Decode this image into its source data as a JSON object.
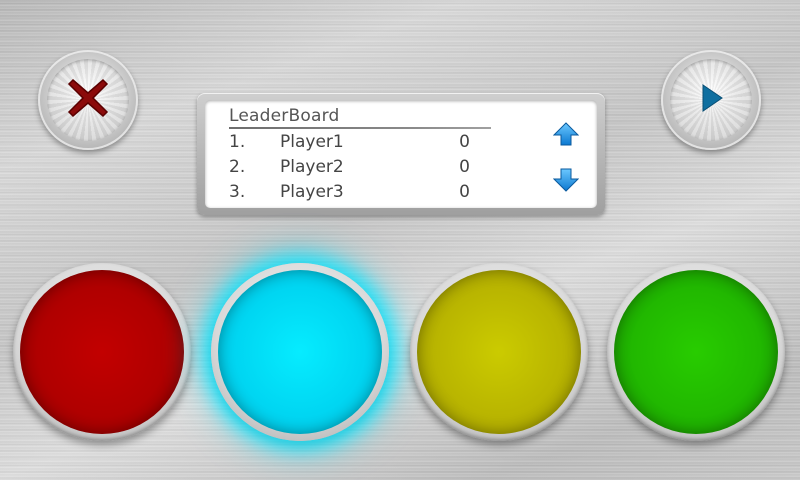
{
  "controls": {
    "close_icon": "close-icon",
    "play_icon": "play-icon",
    "scroll_up_icon": "arrow-up-icon",
    "scroll_down_icon": "arrow-down-icon"
  },
  "leaderboard": {
    "title": "LeaderBoard",
    "entries": [
      {
        "rank": "1.",
        "name": "Player1",
        "score": "0"
      },
      {
        "rank": "2.",
        "name": "Player2",
        "score": "0"
      },
      {
        "rank": "3.",
        "name": "Player3",
        "score": "0"
      }
    ]
  },
  "game_buttons": [
    {
      "color_name": "red",
      "color": "#c00000",
      "lit": false
    },
    {
      "color_name": "cyan",
      "color": "#00e5ff",
      "lit": true
    },
    {
      "color_name": "yellow",
      "color": "#c4c000",
      "lit": false
    },
    {
      "color_name": "green",
      "color": "#24c400",
      "lit": false
    }
  ],
  "colors": {
    "close_x": "#8b0a0a",
    "play_triangle": "#0f6fa0",
    "arrows": "#1e90e0"
  }
}
